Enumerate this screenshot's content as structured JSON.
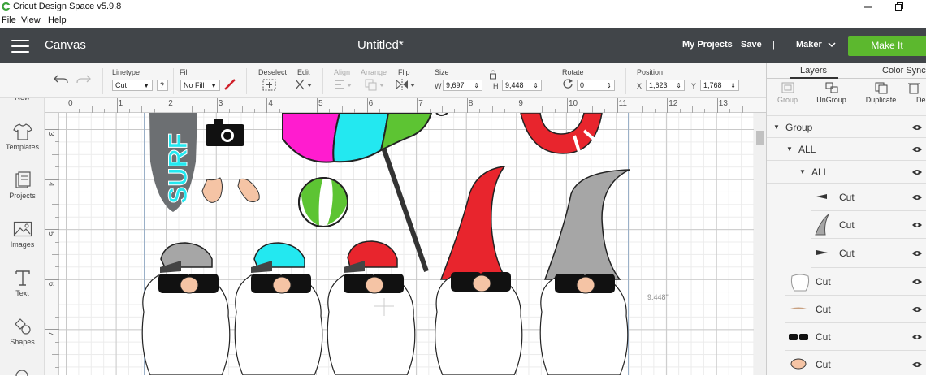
{
  "window": {
    "title": "Cricut Design Space  v5.9.8",
    "minimize_icon": "minimize-icon",
    "restore_icon": "restore-icon"
  },
  "menu": [
    "File",
    "View",
    "Help"
  ],
  "header": {
    "section": "Canvas",
    "doc_title": "Untitled*",
    "my_projects": "My Projects",
    "save": "Save",
    "separator": "|",
    "machine": "Maker",
    "make_it": "Make It",
    "make_it_color": "#5cb82e",
    "bg_color": "#414549"
  },
  "toolbar": {
    "linetype_label": "Linetype",
    "linetype_value": "Cut",
    "help": "?",
    "fill_label": "Fill",
    "fill_value": "No Fill",
    "deselect_label": "Deselect",
    "edit_label": "Edit",
    "align_label": "Align",
    "arrange_label": "Arrange",
    "flip_label": "Flip",
    "size_label": "Size",
    "w_label": "W",
    "w_value": "9,697",
    "h_label": "H",
    "h_value": "9,448",
    "rotate_label": "Rotate",
    "rotate_value": "0",
    "position_label": "Position",
    "x_label": "X",
    "x_value": "1,623",
    "y_label": "Y",
    "y_value": "1,768"
  },
  "leftbar": [
    {
      "label": "New",
      "icon": "plus-circle-icon"
    },
    {
      "label": "Templates",
      "icon": "shirt-icon"
    },
    {
      "label": "Projects",
      "icon": "projects-icon"
    },
    {
      "label": "Images",
      "icon": "image-icon"
    },
    {
      "label": "Text",
      "icon": "text-icon"
    },
    {
      "label": "Shapes",
      "icon": "shapes-icon"
    }
  ],
  "rulers": {
    "h_ticks": [
      "0",
      "1",
      "2",
      "3",
      "4",
      "5",
      "6",
      "7",
      "8",
      "9",
      "10",
      "11",
      "12",
      "13"
    ],
    "v_ticks": [
      "3",
      "4",
      "5",
      "6",
      "7"
    ]
  },
  "canvas": {
    "dimension_label": "9.448\"",
    "surf_text": "SURF"
  },
  "layers": {
    "tab_layers": "Layers",
    "tab_color_sync": "Color Sync",
    "actions": {
      "group": "Group",
      "ungroup": "UnGroup",
      "duplicate": "Duplicate",
      "delete": "Del"
    },
    "rows": [
      {
        "label": "Group"
      },
      {
        "label": "ALL"
      },
      {
        "label": "ALL"
      },
      {
        "label": "Cut"
      },
      {
        "label": "Cut"
      },
      {
        "label": "Cut"
      },
      {
        "label": "Cut"
      },
      {
        "label": "Cut"
      },
      {
        "label": "Cut"
      },
      {
        "label": "Cut"
      }
    ]
  },
  "colors": {
    "magenta": "#ff1ccf",
    "cyan": "#23e8f0",
    "green": "#5dc433",
    "red": "#e8252d",
    "gray": "#a6a6a6",
    "skin": "#f5c4a5",
    "surfboard": "#6c6f72"
  }
}
